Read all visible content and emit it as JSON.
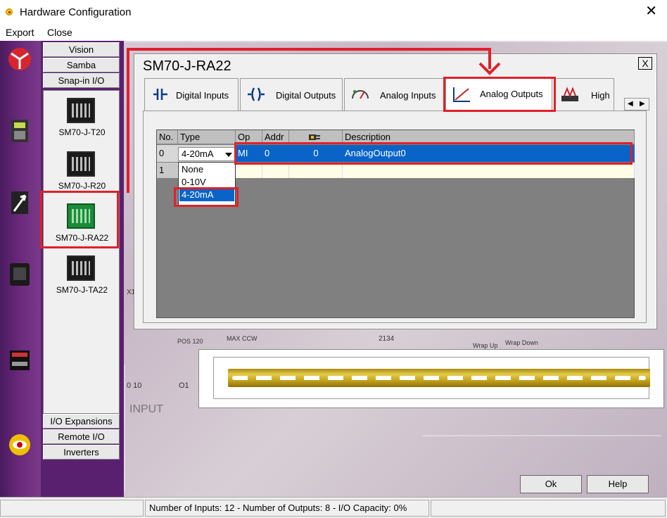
{
  "window": {
    "title": "Hardware Configuration",
    "close": "✕"
  },
  "menu": {
    "items": [
      "Export",
      "Close"
    ]
  },
  "module_tabs": {
    "top": [
      "Vision",
      "Samba",
      "Snap-in I/O"
    ],
    "bottom": [
      "I/O Expansions",
      "Remote I/O",
      "Inverters"
    ]
  },
  "modules": [
    "SM70-J-T20",
    "SM70-J-R20",
    "SM70-J-RA22",
    "SM70-J-TA22"
  ],
  "selected_module": "SM70-J-RA22",
  "dialog": {
    "title": "SM70-J-RA22",
    "close": "X",
    "tabs": [
      {
        "label": "Digital Inputs",
        "icon": "digital-input-icon"
      },
      {
        "label": "Digital Outputs",
        "icon": "digital-output-icon"
      },
      {
        "label": "Analog Inputs",
        "icon": "analog-input-gauge-icon"
      },
      {
        "label": "Analog Outputs",
        "icon": "analog-output-chart-icon"
      },
      {
        "label": "High",
        "icon": "high-speed-icon"
      }
    ],
    "active_tab": "Analog Outputs",
    "scroll": {
      "left": "◀",
      "right": "▶"
    },
    "table": {
      "headers": [
        "No.",
        "Type",
        "Op",
        "Addr",
        "",
        "Description"
      ],
      "rows": [
        {
          "no": "0",
          "type": "4-20mA",
          "op": "MI",
          "addr": "0",
          "val": "0",
          "description": "AnalogOutput0"
        },
        {
          "no": "1",
          "type": "",
          "op": "",
          "addr": "",
          "val": "",
          "description": ""
        }
      ]
    },
    "type_options": [
      "None",
      "0-10V",
      "4-20mA"
    ],
    "type_selected": "4-20mA"
  },
  "background": {
    "input_label": "INPUT",
    "o1": "O1",
    "o010": "0 10",
    "x1": "X1",
    "pos": "POS 120",
    "max": "MAX CCW",
    "wrap_up": "Wrap Up",
    "wrap_down": "Wrap Down",
    "num": "2134"
  },
  "buttons": {
    "ok": "Ok",
    "help": "Help"
  },
  "status": {
    "text": "Number of Inputs: 12  -  Number of Outputs: 8  -  I/O Capacity: 0%"
  },
  "colors": {
    "highlight_red": "#e0202a",
    "selection_blue": "#0a64c8"
  }
}
